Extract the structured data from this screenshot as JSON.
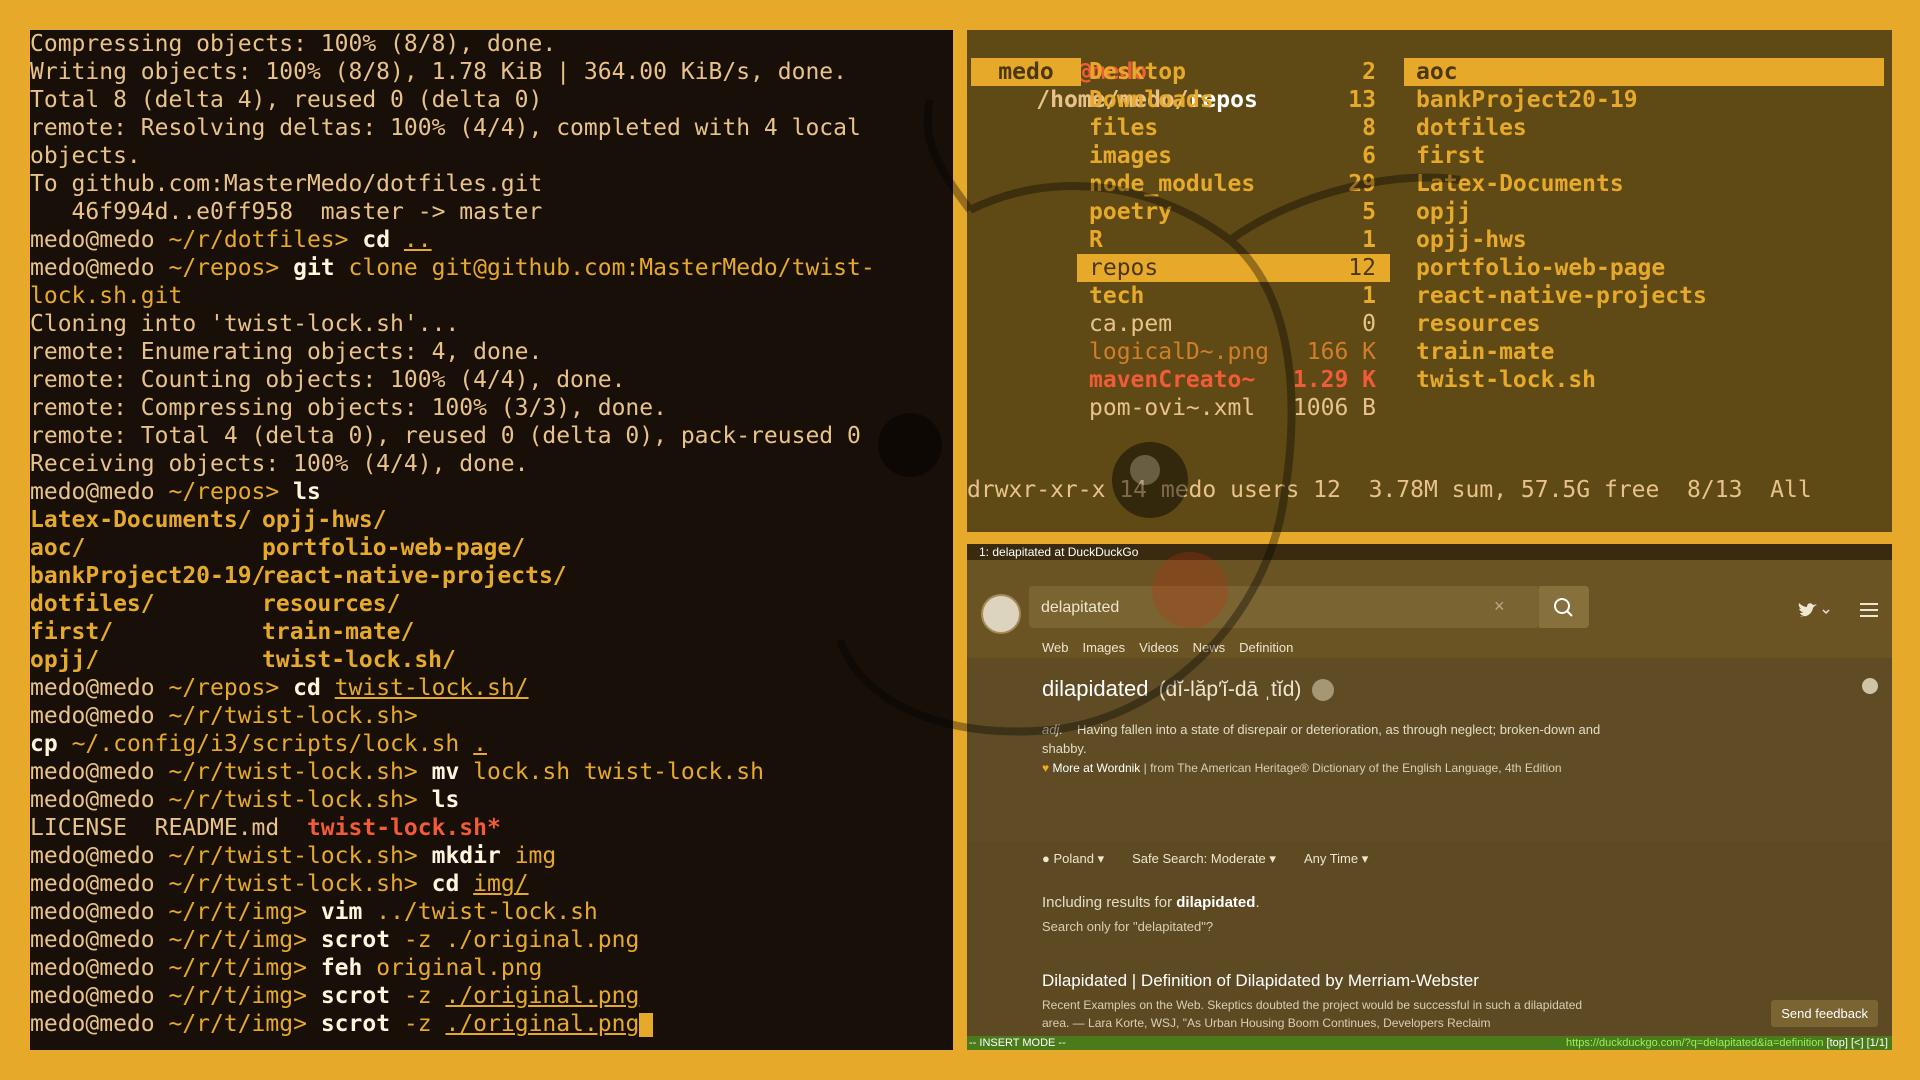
{
  "terminal": {
    "lines": [
      "Compressing objects: 100% (8/8), done.",
      "Writing objects: 100% (8/8), 1.78 KiB | 364.00 KiB/s, done.",
      "Total 8 (delta 4), reused 0 (delta 0)",
      "remote: Resolving deltas: 100% (4/4), completed with 4 local",
      "objects.",
      "To github.com:MasterMedo/dotfiles.git",
      "   46f994d..e0ff958  master -> master"
    ],
    "prompt_user": "medo@medo",
    "sessions": [
      {
        "dir": "~/r/dotfiles>",
        "cmd": "cd",
        "arg": "..",
        "arg_ul": true
      },
      {
        "dir": "~/repos>",
        "cmd": "git",
        "arg": "clone git@github.com:MasterMedo/twist-",
        "arg_ul": false
      }
    ],
    "clone_cont": "lock.sh.git",
    "clone_output": [
      "Cloning into 'twist-lock.sh'...",
      "remote: Enumerating objects: 4, done.",
      "remote: Counting objects: 100% (4/4), done.",
      "remote: Compressing objects: 100% (3/3), done.",
      "remote: Total 4 (delta 0), reused 0 (delta 0), pack-reused 0",
      "Receiving objects: 100% (4/4), done."
    ],
    "ls_prompt_dir": "~/repos>",
    "ls_cmd": "ls",
    "ls_left": [
      "Latex-Documents/",
      "aoc/",
      "bankProject20-19/",
      "dotfiles/",
      "first/",
      "opjj/"
    ],
    "ls_right": [
      "opjj-hws/",
      "portfolio-web-page/",
      "react-native-projects/",
      "resources/",
      "train-mate/",
      "twist-lock.sh/"
    ],
    "after": [
      {
        "dir": "~/repos>",
        "cmd": "cd",
        "arg": "twist-lock.sh/",
        "arg_ul": true
      },
      {
        "dir": "~/r/twist-lock.sh>",
        "cmd": "",
        "arg": "",
        "arg_ul": false
      }
    ],
    "cp_line_cmd": "cp",
    "cp_line_arg": "~/.config/i3/scripts/lock.sh",
    "cp_line_dot": ".",
    "more": [
      {
        "dir": "~/r/twist-lock.sh>",
        "cmd": "mv",
        "arg": "lock.sh twist-lock.sh",
        "arg_ul": false
      },
      {
        "dir": "~/r/twist-lock.sh>",
        "cmd": "ls",
        "arg": "",
        "arg_ul": false
      }
    ],
    "ls2": {
      "a": "LICENSE",
      "b": "README.md",
      "c": "twist-lock.sh*"
    },
    "final": [
      {
        "dir": "~/r/twist-lock.sh>",
        "cmd": "mkdir",
        "arg": "img",
        "arg_ul": false
      },
      {
        "dir": "~/r/twist-lock.sh>",
        "cmd": "cd",
        "arg": "img/",
        "arg_ul": true
      },
      {
        "dir": "~/r/t/img>",
        "cmd": "vim",
        "arg": "../twist-lock.sh",
        "arg_ul": false
      },
      {
        "dir": "~/r/t/img>",
        "cmd": "scrot",
        "arg": "-z ./original.png",
        "arg_ul": false
      },
      {
        "dir": "~/r/t/img>",
        "cmd": "feh",
        "arg": "original.png",
        "arg_ul": false
      },
      {
        "dir": "~/r/t/img>",
        "cmd": "scrot",
        "arg": "-z",
        "arg2": "./original.png",
        "arg_ul": true
      },
      {
        "dir": "~/r/t/img>",
        "cmd": "scrot",
        "arg": "-z",
        "arg2": "./original.png",
        "arg_ul": true,
        "cursor": true
      }
    ]
  },
  "ranger": {
    "path_user": "medo@medo",
    "path_dir": "/home/medo/",
    "path_leaf": "repos",
    "tag": "medo",
    "middle": [
      {
        "name": "Desktop",
        "count": "2",
        "kind": "dir"
      },
      {
        "name": "Downloads",
        "count": "13",
        "kind": "dir"
      },
      {
        "name": "files",
        "count": "8",
        "kind": "dir"
      },
      {
        "name": "images",
        "count": "6",
        "kind": "dir"
      },
      {
        "name": "node_modules",
        "count": "29",
        "kind": "dir"
      },
      {
        "name": "poetry",
        "count": "5",
        "kind": "dir"
      },
      {
        "name": "R",
        "count": "1",
        "kind": "dir"
      },
      {
        "name": "repos",
        "count": "12",
        "kind": "sel"
      },
      {
        "name": "tech",
        "count": "1",
        "kind": "dir"
      },
      {
        "name": "ca.pem",
        "count": "0",
        "kind": "file"
      },
      {
        "name": "logicalD~.png",
        "count": "166 K",
        "kind": "img"
      },
      {
        "name": "mavenCreato~",
        "count": "1.29 K",
        "kind": "exec"
      },
      {
        "name": "pom-ovi~.xml",
        "count": "1006 B",
        "kind": "file"
      }
    ],
    "right": [
      {
        "name": "aoc",
        "kind": "sel"
      },
      {
        "name": "bankProject20-19",
        "kind": "dir"
      },
      {
        "name": "dotfiles",
        "kind": "dir"
      },
      {
        "name": "first",
        "kind": "dir"
      },
      {
        "name": "Latex-Documents",
        "kind": "dir"
      },
      {
        "name": "opjj",
        "kind": "dir"
      },
      {
        "name": "opjj-hws",
        "kind": "dir"
      },
      {
        "name": "portfolio-web-page",
        "kind": "dir"
      },
      {
        "name": "react-native-projects",
        "kind": "dir"
      },
      {
        "name": "resources",
        "kind": "dir"
      },
      {
        "name": "train-mate",
        "kind": "dir"
      },
      {
        "name": "twist-lock.sh",
        "kind": "dir"
      }
    ],
    "status": "drwxr-xr-x 14 medo users 12  3.78M sum, 57.5G free  8/13  All"
  },
  "browser": {
    "tab_title": "1: delapitated at DuckDuckGo",
    "search_value": "delapitated",
    "clear_glyph": "×",
    "tabs": [
      "Web",
      "Images",
      "Videos",
      "News",
      "Definition"
    ],
    "active_tab": "Definition",
    "word": "dilapidated",
    "pron": "(dĭ-lăp′ĭ-dā ˌtĭd)",
    "pos": "adj.",
    "definition": "Having fallen into a state of disrepair or deterioration, as through neglect; broken-down and shabby.",
    "more_label": "More at Wordnik",
    "source": "from The American Heritage® Dictionary of the English Language, 4th Edition",
    "region": "Poland",
    "safe_search": "Safe Search: Moderate",
    "time": "Any Time",
    "including_prefix": "Including results for",
    "including_word": "dilapidated",
    "including_suffix": ".",
    "search_only": "Search only for \"delapitated\"?",
    "result_title": "Dilapidated | Definition of Dilapidated by Merriam-Webster",
    "result_snippet": "Recent Examples on the Web. Skeptics doubted the project would be successful in such a dilapidated area. — Lara Korte, WSJ, \"As Urban Housing Boom Continues, Developers Reclaim",
    "feedback": "Send feedback",
    "mode": "-- INSERT MODE --",
    "url": "https://duckduckgo.com/?q=delapitated&ia=definition",
    "url_tail": "[top] [<] [1/1]"
  },
  "colors": {
    "wallpaper": "#e7a92a",
    "terminal_bg": "#181008",
    "accent": "#f15b37"
  }
}
